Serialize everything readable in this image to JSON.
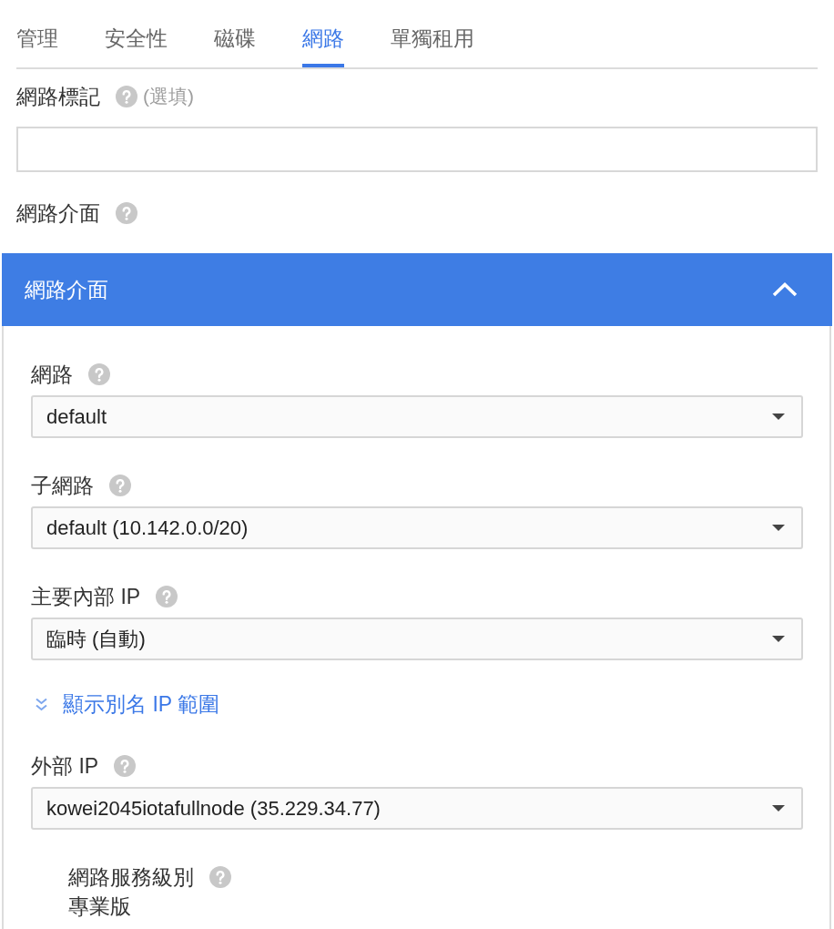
{
  "tabs": [
    {
      "label": "管理",
      "selected": false
    },
    {
      "label": "安全性",
      "selected": false
    },
    {
      "label": "磁碟",
      "selected": false
    },
    {
      "label": "網路",
      "selected": true
    },
    {
      "label": "單獨租用",
      "selected": false
    }
  ],
  "network_tags": {
    "label": "網路標記",
    "help": true,
    "hint": "(選填)"
  },
  "network_interfaces": {
    "label": "網路介面",
    "help": true
  },
  "interface_panel": {
    "title": "網路介面",
    "expanded": true,
    "fields": [
      {
        "kind": "select",
        "label": "網路",
        "help": true,
        "value": "default"
      },
      {
        "kind": "select",
        "label": "子網路",
        "help": true,
        "value": "default (10.142.0.0/20)"
      },
      {
        "kind": "select",
        "label": "主要內部 IP",
        "help": true,
        "value": "臨時 (自動)"
      },
      {
        "kind": "link",
        "label": "顯示別名 IP 範圍"
      },
      {
        "kind": "select",
        "label": "外部 IP",
        "help": true,
        "value": "kowei2045iotafullnode (35.229.34.77)"
      },
      {
        "kind": "info",
        "label": "網路服務級別",
        "help": true,
        "value": "專業版"
      }
    ]
  }
}
